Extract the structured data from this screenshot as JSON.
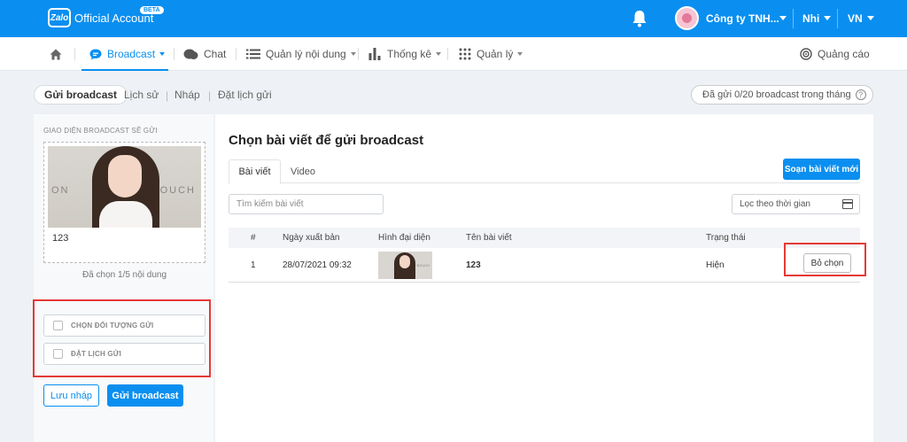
{
  "header": {
    "logo_badge": "Zalo",
    "logo_text": "Official Account",
    "beta": "BETA",
    "company": "Công ty TNH...",
    "user": "Nhi",
    "language": "VN"
  },
  "nav": {
    "items": [
      {
        "label": "Broadcast",
        "active": true
      },
      {
        "label": "Chat"
      },
      {
        "label": "Quản lý nội dung"
      },
      {
        "label": "Thống kê"
      },
      {
        "label": "Quản lý"
      }
    ],
    "ads": "Quảng cáo"
  },
  "subtabs": {
    "active": "Gửi broadcast",
    "history": "Lịch sử",
    "drafts": "Nháp",
    "schedule": "Đặt lịch gửi",
    "sent_count": "Đã gửi 0/20 broadcast trong tháng",
    "help_glyph": "?"
  },
  "left": {
    "title": "GIAO DIỆN BROADCAST SẼ GỬI",
    "photo_wall_left": "ON",
    "photo_wall_right": "BOUCH",
    "preview_name": "123",
    "selected_count": "Đã chọn 1/5 nội dung",
    "option_audience": "CHỌN ĐỐI TƯỢNG GỬI",
    "option_schedule": "ĐẶT LỊCH GỬI",
    "save_draft": "Lưu nháp",
    "send": "Gửi broadcast"
  },
  "main": {
    "title": "Chọn bài viết để gửi broadcast",
    "tabs": [
      "Bài viết",
      "Video"
    ],
    "compose": "Soạn bài viết mới",
    "search_placeholder": "Tìm kiếm bài viết",
    "date_filter": "Lọc theo thời gian",
    "columns": [
      "#",
      "Ngày xuất bản",
      "Hình đại diện",
      "Tên bài viết",
      "Trạng thái"
    ],
    "rows": [
      {
        "index": "1",
        "date": "28/07/2021 09:32",
        "title": "123",
        "status": "Hiện",
        "action": "Bỏ chọn"
      }
    ]
  },
  "colors": {
    "brand": "#0a8ff0",
    "highlight": "#e53935"
  }
}
